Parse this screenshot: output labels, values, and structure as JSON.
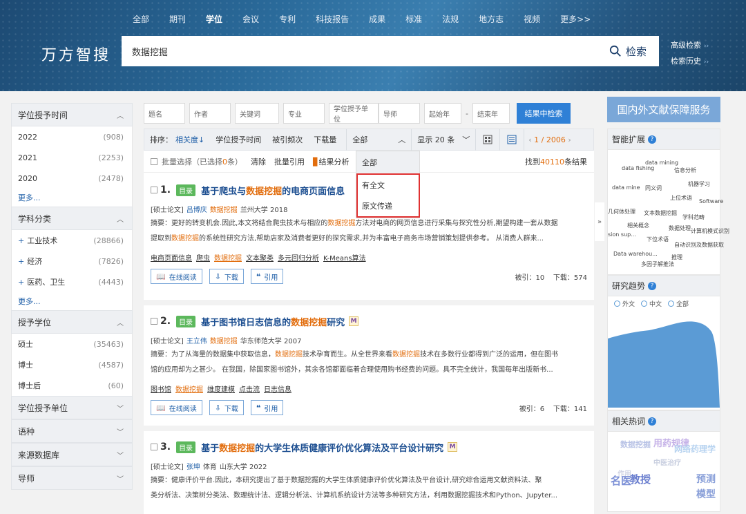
{
  "header": {
    "nav": [
      "全部",
      "期刊",
      "学位",
      "会议",
      "专利",
      "科技报告",
      "成果",
      "标准",
      "法规",
      "地方志",
      "视频",
      "更多>>"
    ],
    "active_nav": "学位",
    "logo": "万方智搜",
    "query": "数据挖掘",
    "search_label": "检索",
    "advanced": "高级检索",
    "history": "检索历史"
  },
  "left": {
    "sec1": {
      "title": "学位授予时间",
      "rows": [
        [
          "2022",
          "(908)"
        ],
        [
          "2021",
          "(2253)"
        ],
        [
          "2020",
          "(2478)"
        ]
      ],
      "more": "更多..."
    },
    "sec2": {
      "title": "学科分类",
      "rows": [
        [
          "工业技术",
          "(28866)"
        ],
        [
          "经济",
          "(7826)"
        ],
        [
          "医药、卫生",
          "(4443)"
        ]
      ],
      "more": "更多..."
    },
    "sec3": {
      "title": "授予学位",
      "rows": [
        [
          "硕士",
          "(35463)"
        ],
        [
          "博士",
          "(4587)"
        ],
        [
          "博士后",
          "(60)"
        ]
      ]
    },
    "collapsed": [
      "学位授予单位",
      "语种",
      "来源数据库",
      "导师"
    ]
  },
  "filters": {
    "fields": [
      "题名",
      "作者",
      "关键词",
      "专业",
      "学位授予单位",
      "导师",
      "起始年",
      "结束年"
    ],
    "dash": "-",
    "button": "结果中检索"
  },
  "toolbar": {
    "sort_label": "排序：",
    "relevance": "相关度",
    "by_time": "学位授予时间",
    "by_cited": "被引频次",
    "by_download": "下载量",
    "scope": "全部",
    "display": "显示 20 条",
    "page": "1 / 2006"
  },
  "bar2": {
    "batch": "批量选择（已选择",
    "batch_count": "0",
    "batch_end": "条）",
    "clear": "清除",
    "cite": "批量引用",
    "analyze": "结果分析",
    "found_pre": "找到",
    "found_num": "40110",
    "found_post": "条结果"
  },
  "dropdown": {
    "first": "全部",
    "options": [
      "有全文",
      "原文传递"
    ]
  },
  "results": [
    {
      "num": "1.",
      "tag": "目录",
      "title_pre": "基于爬虫与",
      "title_hl": "数据挖掘",
      "title_post": "的电商页面信息",
      "type": "[硕士论文]",
      "author": "吕博庆",
      "keyword": "数据挖掘",
      "school": "兰州大学 2018",
      "abs1_pre": "摘要：更好的转变机会.因此,本文将结合爬虫技术与相应的",
      "abs1_hl": "数据挖掘",
      "abs1_post": "方法对电商的网页信息进行采集与探究性分析,期望构建一套从数据",
      "abs2_pre": "提取到",
      "abs2_hl": "数据挖掘",
      "abs2_post": "的系统性研究方法,帮助店家及消费者更好的探究需求,并为丰富电子商务市场营销策划提供参考。   从消费人群来...",
      "kws": [
        "电商页面信息",
        "爬虫",
        "数据挖掘",
        "文本聚类",
        "多元回归分析",
        "K-Means算法"
      ],
      "read": "在线阅读",
      "download": "下载",
      "cite": "引用",
      "cited": "被引：10",
      "downloads": "下载：574"
    },
    {
      "num": "2.",
      "tag": "目录",
      "title_pre": "基于图书馆日志信息的",
      "title_hl": "数据挖掘",
      "title_post": "研究",
      "badge": "M",
      "type": "[硕士论文]",
      "author": "王立伟",
      "keyword": "数据挖掘",
      "school": "华东师范大学 2007",
      "abs1_pre": "摘要：为了从海量的数据集中获取信息，",
      "abs1_hl": "数据挖掘",
      "abs1_mid": "技术孕育而生。从全世界来看",
      "abs1_hl2": "数据挖掘",
      "abs1_post": "技术在多数行业都得到广泛的运用，但在图书",
      "abs2": "馆的应用却为之甚少。 在我国，除国家图书馆外，其余各馆都面临着合理使用购书经费的问题。具不完全统计，我国每年出版新书...",
      "kws": [
        "图书馆",
        "数据挖掘",
        "维度建模",
        "点击流",
        "日志信息"
      ],
      "read": "在线阅读",
      "download": "下载",
      "cite": "引用",
      "cited": "被引：6",
      "downloads": "下载：141"
    },
    {
      "num": "3.",
      "tag": "目录",
      "title_pre": "基于",
      "title_hl": "数据挖掘",
      "title_post": "的大学生体质健康评价优化算法及平台设计研究",
      "badge": "M",
      "type": "[硕士论文]",
      "author": "张坤",
      "keyword": "体育",
      "school": "山东大学 2022",
      "abs1": "摘要：健康评价平台.因此，本研究提出了基于数据挖掘的大学生体质健康评价优化算法及平台设计,研究综合运用文献资料法、聚",
      "abs2": "类分析法、决策树分类法、数理统计法、逻辑分析法、计算机系统设计方法等多种研究方法，利用数据挖掘技术和Python、Jupyter..."
    }
  ],
  "right": {
    "service": "国内外文献保障服务",
    "smart": "智能扩展",
    "cloud": [
      "data mining",
      "data fishing",
      "信息分析",
      "data mine",
      "同义词",
      "机器学习",
      "上位术语",
      "Software",
      "几何体处理",
      "文本数据挖掘",
      "学科范畴",
      "相关概念",
      "数据处理",
      "计算机模式识别",
      "sion sup...",
      "下位术语",
      "自动识别及数据获取",
      "Data warehou...",
      "推理",
      "多因子解推法"
    ],
    "trend": "研究趋势",
    "legend": [
      "外文",
      "中文",
      "全部"
    ],
    "hot": "相关热词",
    "hot_words": [
      "数据挖掘",
      "用药规律",
      "网络药理学",
      "中医治疗",
      "作用",
      "名医",
      "教授",
      "预测",
      "模型"
    ]
  },
  "colors": {
    "brand": "#1d4a73",
    "accent": "#2f80d6",
    "highlight": "#e26d0d",
    "tag": "#5cb85c"
  }
}
